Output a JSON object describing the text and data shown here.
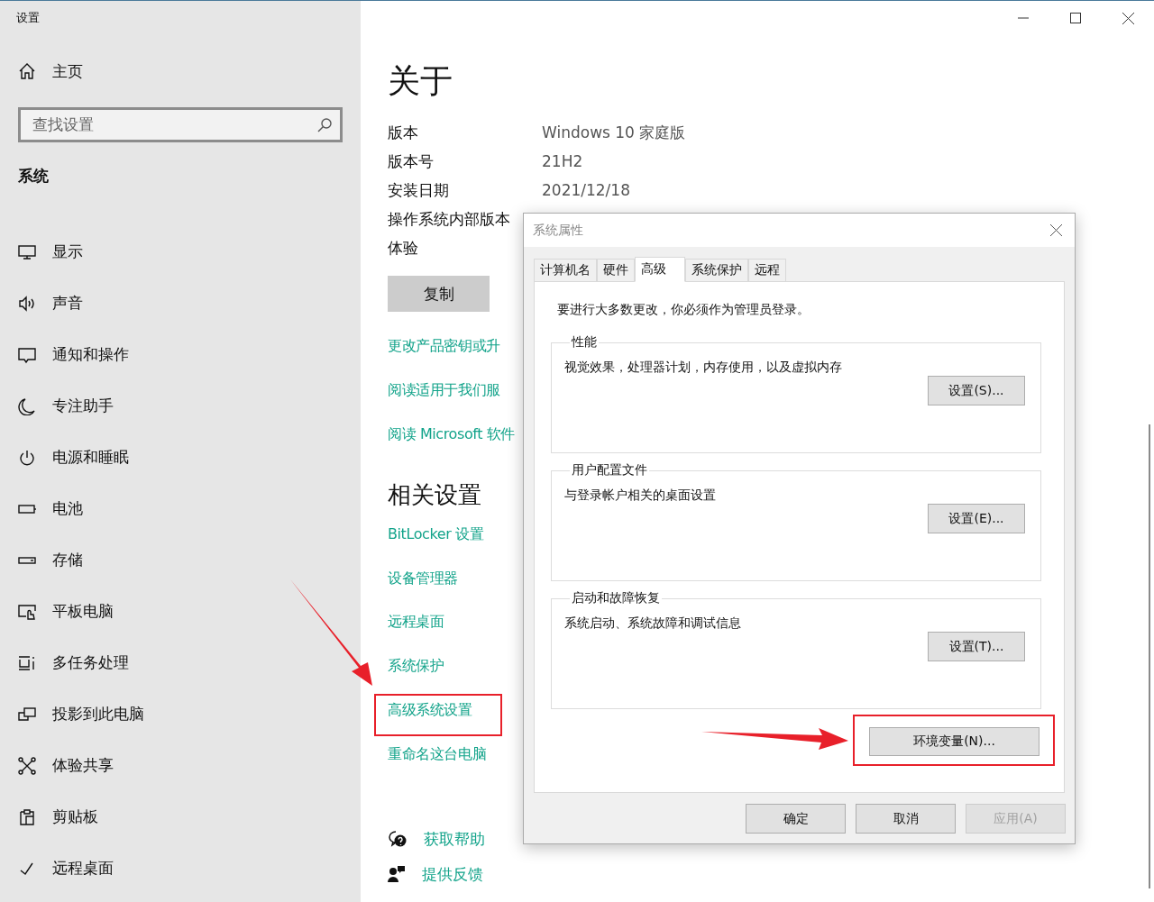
{
  "window": {
    "title": "设置"
  },
  "sidebar": {
    "home": "主页",
    "search": {
      "placeholder": "查找设置"
    },
    "section": "系统",
    "items": [
      {
        "label": "显示"
      },
      {
        "label": "声音"
      },
      {
        "label": "通知和操作"
      },
      {
        "label": "专注助手"
      },
      {
        "label": "电源和睡眠"
      },
      {
        "label": "电池"
      },
      {
        "label": "存储"
      },
      {
        "label": "平板电脑"
      },
      {
        "label": "多任务处理"
      },
      {
        "label": "投影到此电脑"
      },
      {
        "label": "体验共享"
      },
      {
        "label": "剪贴板"
      },
      {
        "label": "远程桌面"
      }
    ]
  },
  "main": {
    "title": "关于",
    "specs": [
      {
        "label": "版本",
        "value": "Windows 10 家庭版"
      },
      {
        "label": "版本号",
        "value": "21H2"
      },
      {
        "label": "安装日期",
        "value": "2021/12/18"
      },
      {
        "label": "操作系统内部版本"
      },
      {
        "label": "体验"
      }
    ],
    "copy_button": "复制",
    "links": [
      "更改产品密钥或升",
      "阅读适用于我们服",
      "阅读 Microsoft 软件"
    ],
    "related_title": "相关设置",
    "related_links": [
      "BitLocker 设置",
      "设备管理器",
      "远程桌面",
      "系统保护",
      "高级系统设置",
      "重命名这台电脑"
    ],
    "help_links": [
      "获取帮助",
      "提供反馈"
    ]
  },
  "dialog": {
    "title": "系统属性",
    "tabs": [
      {
        "label": "计算机名",
        "selected": false
      },
      {
        "label": "硬件",
        "selected": false
      },
      {
        "label": "高级",
        "selected": true
      },
      {
        "label": "系统保护",
        "selected": false
      },
      {
        "label": "远程",
        "selected": false
      }
    ],
    "admin_note": "要进行大多数更改，你必须作为管理员登录。",
    "groups": [
      {
        "title": "性能",
        "description": "视觉效果，处理器计划，内存使用，以及虚拟内存",
        "button": "设置(S)..."
      },
      {
        "title": "用户配置文件",
        "description": "与登录帐户相关的桌面设置",
        "button": "设置(E)..."
      },
      {
        "title": "启动和故障恢复",
        "description": "系统启动、系统故障和调试信息",
        "button": "设置(T)..."
      }
    ],
    "env_button": "环境变量(N)...",
    "buttons": [
      {
        "label": "确定",
        "disabled": false
      },
      {
        "label": "取消",
        "disabled": false
      },
      {
        "label": "应用(A)",
        "disabled": true
      }
    ]
  }
}
